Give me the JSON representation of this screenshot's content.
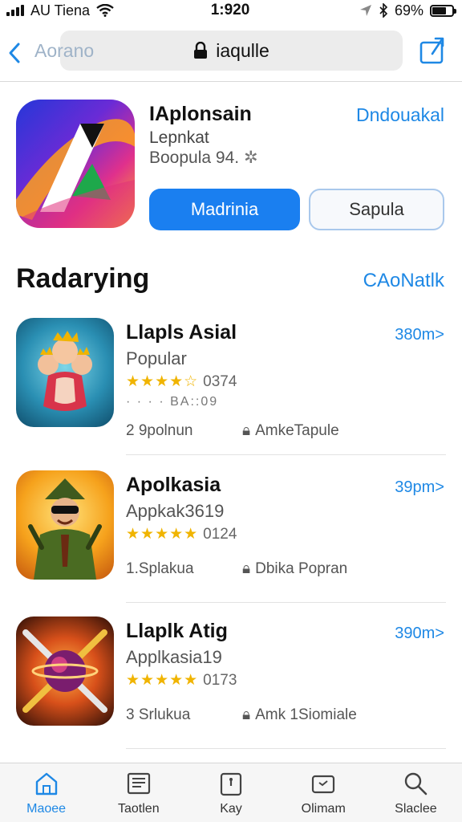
{
  "status_bar": {
    "carrier": "AU Tiena",
    "time": "1:920",
    "battery": "69%",
    "battery_level": 0.69
  },
  "nav": {
    "back_label": "Aorano",
    "url": "iaqulle"
  },
  "header": {
    "title": "IAplonsain",
    "subtitle": "Lepnkat",
    "meta": "Boopula 94.",
    "link": "Dndouakal",
    "primary_button": "Madrinia",
    "secondary_button": "Sapula"
  },
  "section": {
    "title": "Radarying",
    "link": "CAoNatlk"
  },
  "apps": [
    {
      "name": "Llapls Asial",
      "category": "Popular",
      "stars": "★★★★☆",
      "rating": "0374",
      "extra": "· · · · BA::09",
      "size": "2 9polnun",
      "developer": "AmkeTapule",
      "price": "380m>",
      "icon_name": "heroes-game-icon"
    },
    {
      "name": "Apolkasia",
      "category": "Appkak3619",
      "stars": "★★★★★",
      "rating": "0124",
      "extra": "",
      "size": "1.Splakua",
      "developer": "Dbika Popran",
      "price": "39pm>",
      "icon_name": "adventurer-game-icon"
    },
    {
      "name": "Llaplk Atig",
      "category": "Applkasia19",
      "stars": "★★★★★",
      "rating": "0173",
      "extra": "",
      "size": "3 Srlukua",
      "developer": "Amk 1Siomiale",
      "price": "390m>",
      "icon_name": "planet-swords-icon"
    }
  ],
  "tabs": [
    {
      "label": "Maoee",
      "icon": "home-icon",
      "active": true
    },
    {
      "label": "Taotlen",
      "icon": "news-icon",
      "active": false
    },
    {
      "label": "Kay",
      "icon": "games-icon",
      "active": false
    },
    {
      "label": "Olimam",
      "icon": "apps-icon",
      "active": false
    },
    {
      "label": "Slaclee",
      "icon": "search-icon",
      "active": false
    }
  ],
  "colors": {
    "accent": "#1e88e5",
    "primary_button": "#1a7ff0",
    "star": "#f0b400"
  }
}
